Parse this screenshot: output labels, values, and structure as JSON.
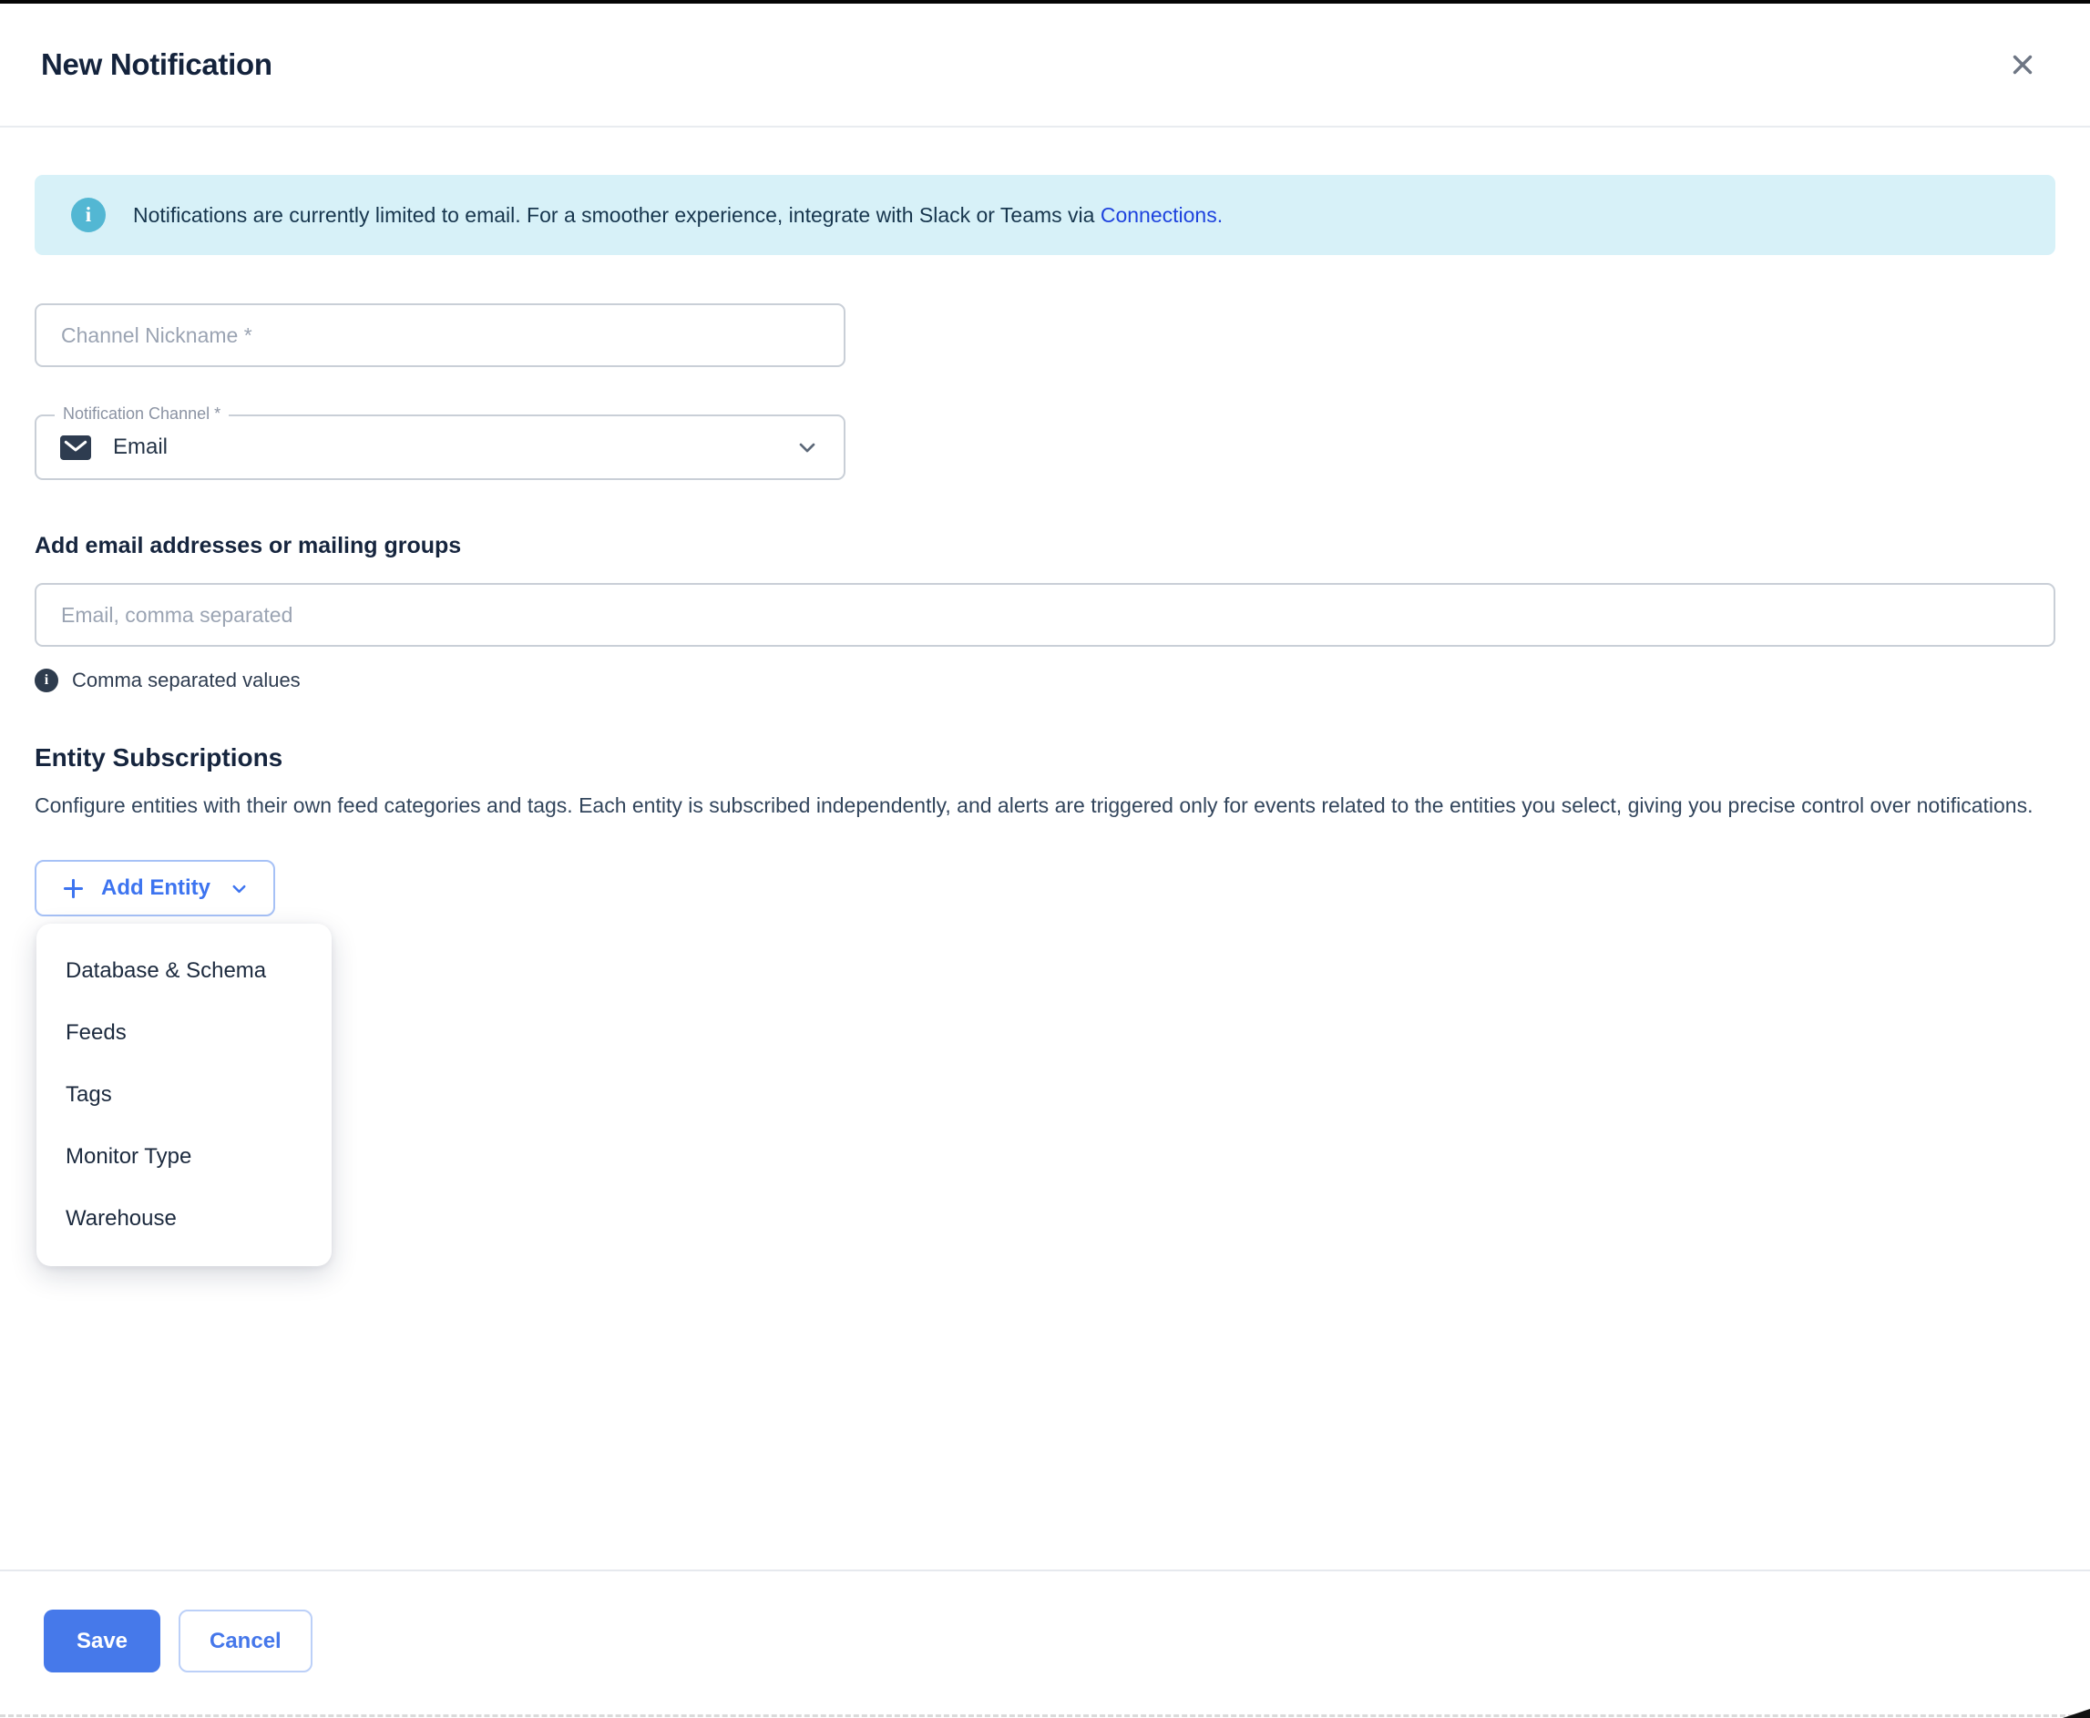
{
  "dialog": {
    "title": "New Notification"
  },
  "banner": {
    "message": "Notifications are currently limited to email. For a smoother experience, integrate with Slack or Teams via ",
    "link": "Connections."
  },
  "fields": {
    "channel_nickname_placeholder": "Channel Nickname *",
    "notification_channel_label": "Notification Channel *",
    "notification_channel_value": "Email"
  },
  "email_section": {
    "heading": "Add email addresses or mailing groups",
    "placeholder": "Email, comma separated",
    "helper": "Comma separated values",
    "info_glyph": "i"
  },
  "entity_section": {
    "heading": "Entity Subscriptions",
    "description": "Configure entities with their own feed categories and tags. Each entity is subscribed independently, and alerts are triggered only for events related to the entities you select, giving you precise control over notifications.",
    "add_entity": "Add Entity",
    "menu": [
      "Database & Schema",
      "Feeds",
      "Tags",
      "Monitor Type",
      "Warehouse"
    ]
  },
  "footer": {
    "save": "Save",
    "cancel": "Cancel"
  },
  "colors": {
    "accent_blue": "#3d74f0",
    "link_blue": "#1e43de",
    "save_bg": "#4679ea",
    "banner_bg": "#d7f1f8",
    "banner_icon": "#53b7d3",
    "heading_navy": "#16253e"
  },
  "banner_icon_glyph": "i"
}
